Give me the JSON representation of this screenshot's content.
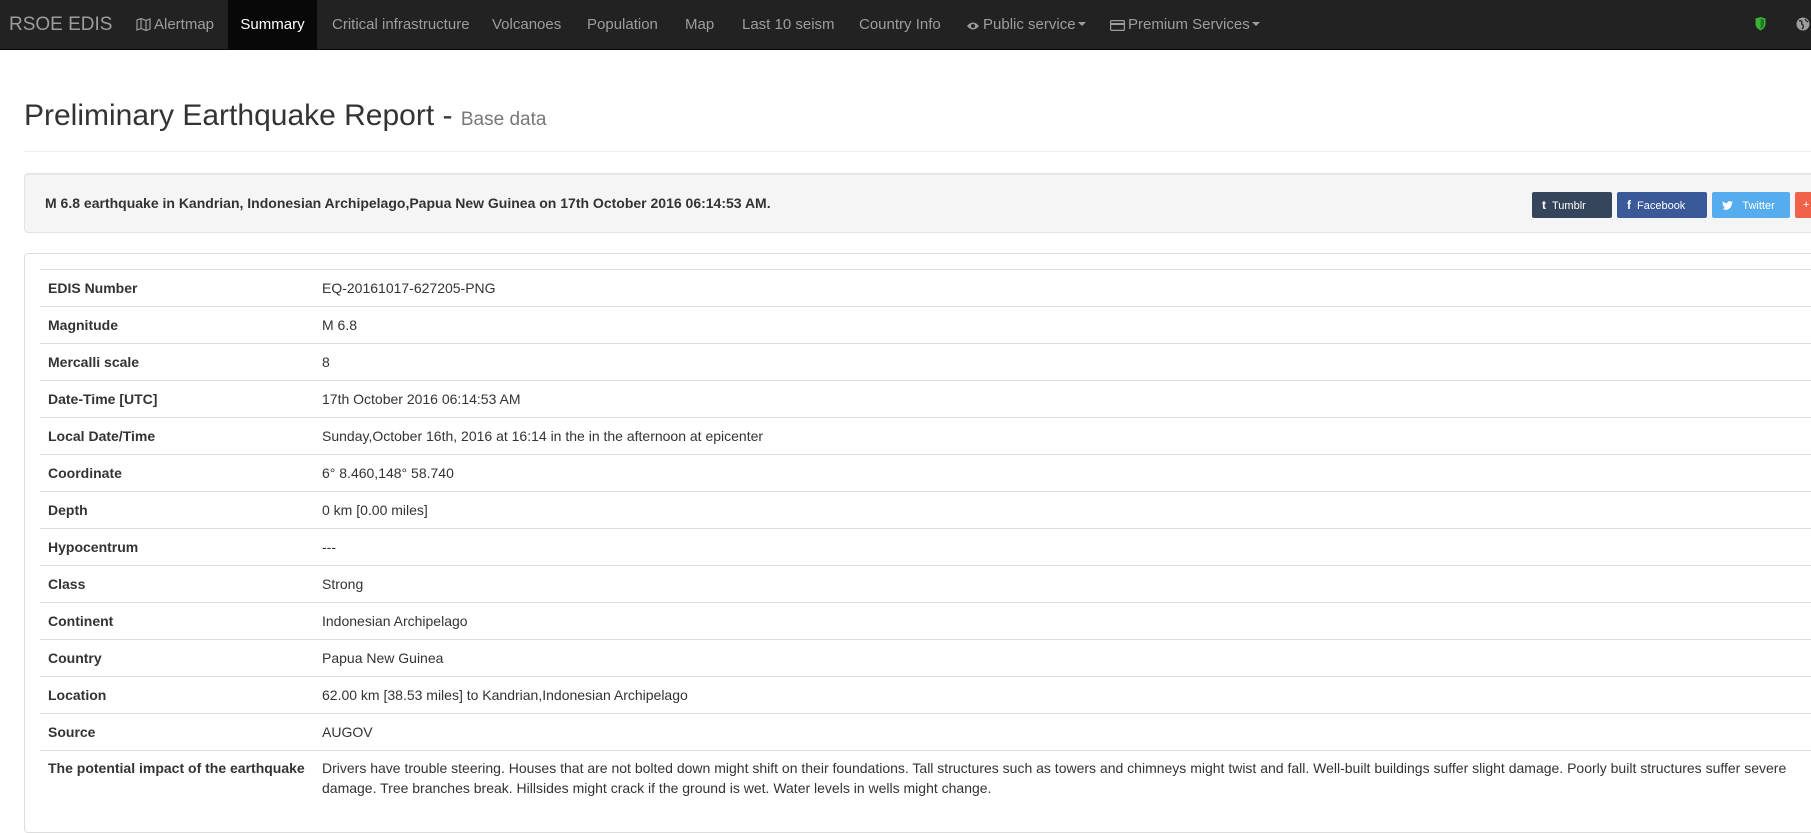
{
  "navbar": {
    "brand": "RSOE EDIS",
    "items": [
      {
        "label": "Alertmap",
        "icon": "map-icon"
      },
      {
        "label": "Summary",
        "active": true
      },
      {
        "label": "Critical infrastructure"
      },
      {
        "label": "Volcanoes"
      },
      {
        "label": "Population"
      },
      {
        "label": "Map"
      },
      {
        "label": "Last 10 seism"
      },
      {
        "label": "Country Info"
      },
      {
        "label": "Public service",
        "icon": "eye-icon",
        "dropdown": true
      },
      {
        "label": "Premium Services",
        "icon": "credit-card-icon",
        "dropdown": true
      }
    ],
    "right_icons": [
      "shield-icon",
      "globe-icon"
    ],
    "colors": {
      "background": "#222222",
      "text": "#9d9d9d",
      "active_bg": "#080808",
      "shield": "#3ab23a"
    }
  },
  "header": {
    "title": "Preliminary Earthquake Report - ",
    "subtitle": "Base data"
  },
  "summary": {
    "text": "M 6.8 earthquake in Kandrian, Indonesian Archipelago,Papua New Guinea on 17th October 2016 06:14:53 AM.",
    "share": {
      "tumblr": "Tumblr",
      "facebook": "Facebook",
      "twitter": "Twitter",
      "plus": "+"
    },
    "share_colors": {
      "tumblr": "#35465c",
      "facebook": "#3b5998",
      "twitter": "#55acee",
      "plus": "#f1624a"
    }
  },
  "details": [
    {
      "key": "EDIS Number",
      "value": "EQ-20161017-627205-PNG"
    },
    {
      "key": "Magnitude",
      "value": "M 6.8"
    },
    {
      "key": "Mercalli scale",
      "value": "8"
    },
    {
      "key": "Date-Time [UTC]",
      "value": "17th October 2016 06:14:53 AM"
    },
    {
      "key": "Local Date/Time",
      "value": "Sunday,October 16th, 2016 at 16:14 in the in the afternoon at epicenter"
    },
    {
      "key": "Coordinate",
      "value": "6° 8.460,148° 58.740"
    },
    {
      "key": "Depth",
      "value": "0 km [0.00 miles]"
    },
    {
      "key": "Hypocentrum",
      "value": "---"
    },
    {
      "key": "Class",
      "value": "Strong"
    },
    {
      "key": "Continent",
      "value": "Indonesian Archipelago"
    },
    {
      "key": "Country",
      "value": "Papua New Guinea"
    },
    {
      "key": "Location",
      "value": "62.00 km [38.53 miles] to Kandrian,Indonesian Archipelago"
    },
    {
      "key": "Source",
      "value": "AUGOV"
    },
    {
      "key": "The potential impact of the earthquake",
      "value": "Drivers have trouble steering. Houses that are not bolted down might shift on their foundations. Tall structures such as towers and chimneys might twist and fall. Well-built buildings suffer slight damage. Poorly built structures suffer severe damage. Tree branches break. Hillsides might crack if the ground is wet. Water levels in wells might change."
    }
  ]
}
